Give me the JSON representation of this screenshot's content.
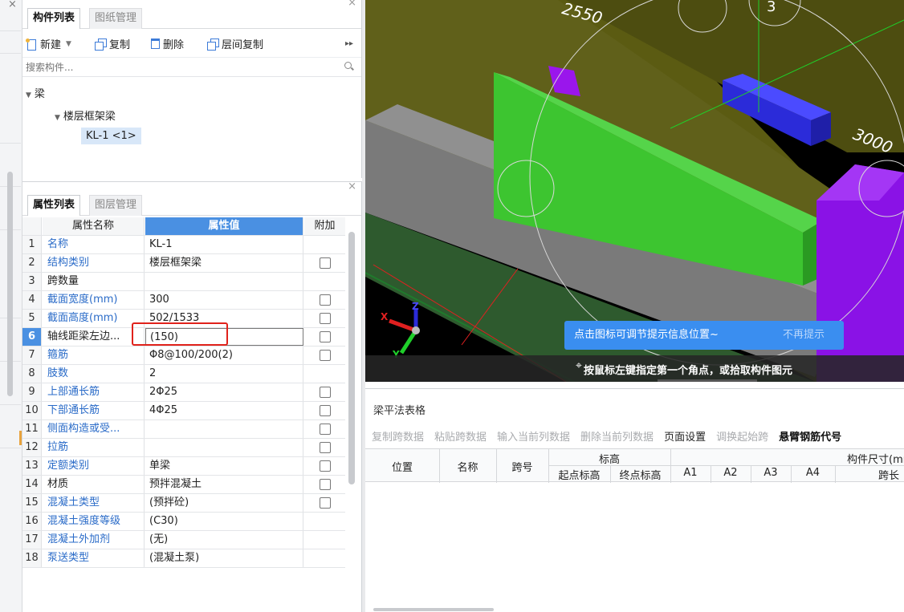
{
  "component_panel": {
    "tabs": [
      "构件列表",
      "图纸管理"
    ],
    "toolbar": {
      "new": "新建",
      "copy": "复制",
      "delete": "删除",
      "floor_copy": "层间复制"
    },
    "search_placeholder": "搜索构件...",
    "tree": {
      "root": "梁",
      "child": "楼层框架梁",
      "leaf": "KL-1 <1>"
    }
  },
  "property_panel": {
    "tabs": [
      "属性列表",
      "图层管理"
    ],
    "headers": {
      "name": "属性名称",
      "value": "属性值",
      "extra": "附加"
    },
    "rows": [
      {
        "num": "1",
        "name": "名称",
        "value": "KL-1",
        "check": false,
        "link": true
      },
      {
        "num": "2",
        "name": "结构类别",
        "value": "楼层框架梁",
        "check": true,
        "link": true
      },
      {
        "num": "3",
        "name": "跨数量",
        "value": "",
        "check": false,
        "link": false
      },
      {
        "num": "4",
        "name": "截面宽度(mm)",
        "value": "300",
        "check": true,
        "link": true
      },
      {
        "num": "5",
        "name": "截面高度(mm)",
        "value": "502/1533",
        "check": true,
        "link": true
      },
      {
        "num": "6",
        "name": "轴线距梁左边...",
        "value": "(150)",
        "check": true,
        "link": false
      },
      {
        "num": "7",
        "name": "箍筋",
        "value": "Φ8@100/200(2)",
        "check": true,
        "link": true
      },
      {
        "num": "8",
        "name": "肢数",
        "value": "2",
        "check": false,
        "link": true
      },
      {
        "num": "9",
        "name": "上部通长筋",
        "value": "2Φ25",
        "check": true,
        "link": true
      },
      {
        "num": "10",
        "name": "下部通长筋",
        "value": "4Φ25",
        "check": true,
        "link": true
      },
      {
        "num": "11",
        "name": "侧面构造或受...",
        "value": "",
        "check": true,
        "link": true
      },
      {
        "num": "12",
        "name": "拉筋",
        "value": "",
        "check": true,
        "link": true
      },
      {
        "num": "13",
        "name": "定额类别",
        "value": "单梁",
        "check": true,
        "link": true
      },
      {
        "num": "14",
        "name": "材质",
        "value": "预拌混凝土",
        "check": true,
        "link": false
      },
      {
        "num": "15",
        "name": "混凝土类型",
        "value": "(预拌砼)",
        "check": true,
        "link": true
      },
      {
        "num": "16",
        "name": "混凝土强度等级",
        "value": "(C30)",
        "check": false,
        "link": true
      },
      {
        "num": "17",
        "name": "混凝土外加剂",
        "value": "(无)",
        "check": false,
        "link": true
      },
      {
        "num": "18",
        "name": "泵送类型",
        "value": "(混凝土泵)",
        "check": false,
        "link": true
      }
    ]
  },
  "viewport": {
    "dim_2550": "2550",
    "dim_3000": "3000",
    "axis_3": "3",
    "axis_x": "X",
    "axis_z": "Z",
    "axis_y": "Y",
    "tip_text": "点击图标可调节提示信息位置~",
    "tip_dismiss": "不再提示",
    "status_text": "按鼠标左键指定第一个角点，或拾取构件图元"
  },
  "beam_table": {
    "title": "梁平法表格",
    "tools": [
      "复制跨数据",
      "粘贴跨数据",
      "输入当前列数据",
      "删除当前列数据",
      "页面设置",
      "调换起始跨",
      "悬臂钢筋代号"
    ],
    "headers": {
      "position": "位置",
      "name": "名称",
      "span": "跨号",
      "elevation": "标高",
      "start_elev": "起点标高",
      "end_elev": "终点标高",
      "a1": "A1",
      "a2": "A2",
      "a3": "A3",
      "a4": "A4",
      "dims": "构件尺寸(mm)",
      "span_len": "跨长"
    }
  },
  "colors": {
    "accent": "#4a90e2",
    "beam_green": "#3dc530",
    "purple": "#8a12e6",
    "blue_block": "#2b2bd9",
    "highlight_red": "#e0221b"
  }
}
